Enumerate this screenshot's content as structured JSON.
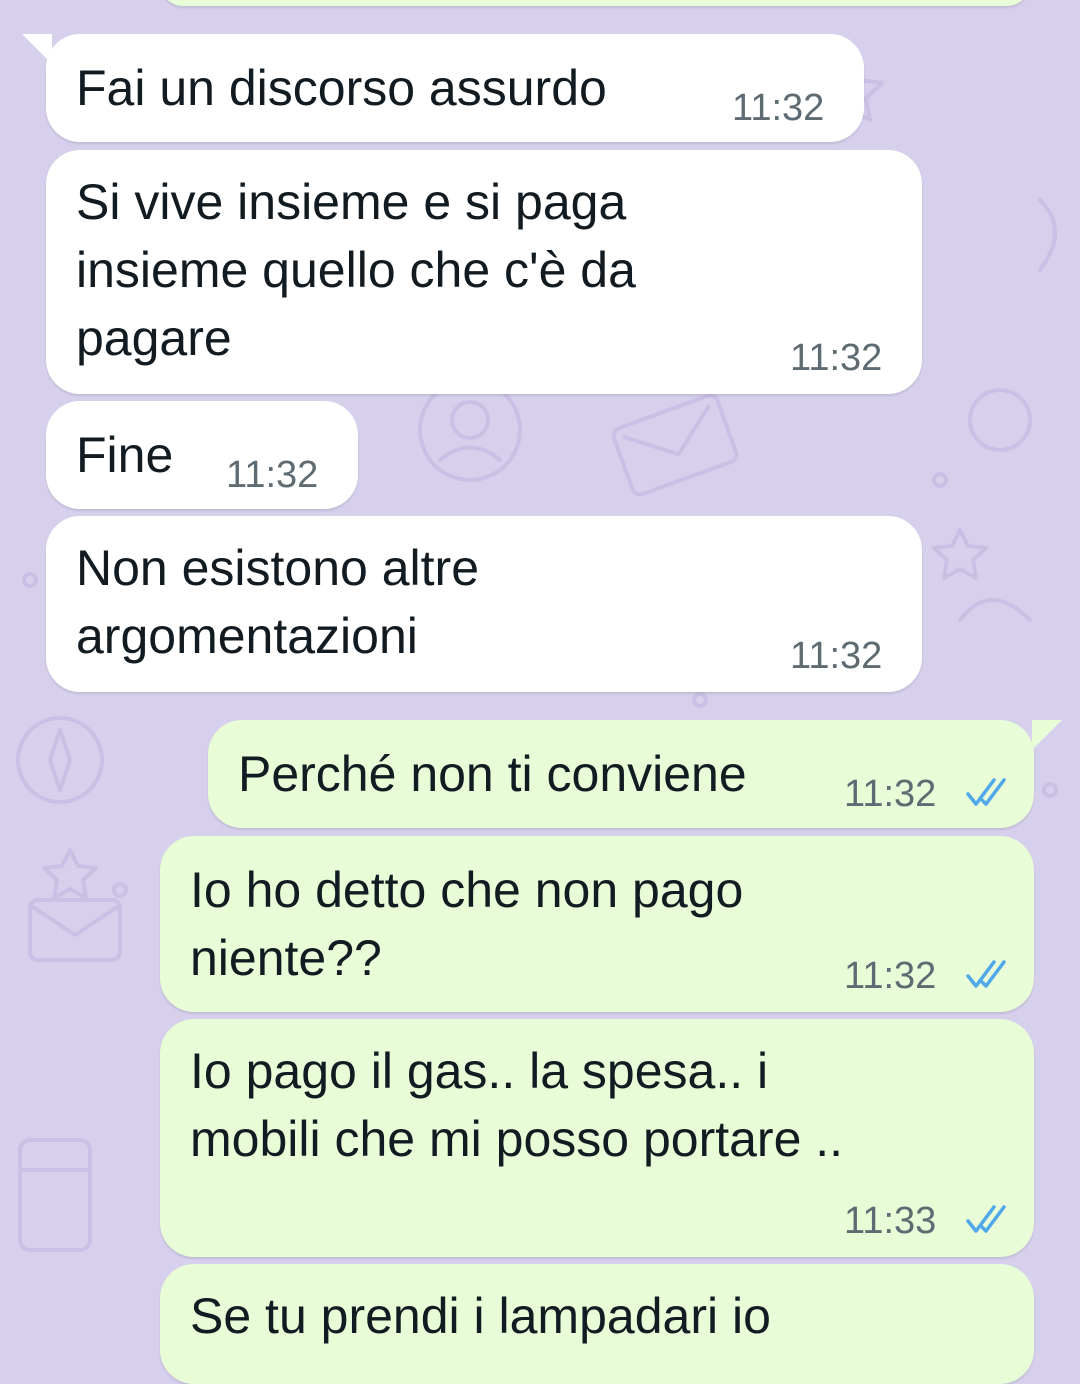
{
  "chat": {
    "messages": [
      {
        "direction": "incoming",
        "text": "Fai un discorso assurdo",
        "time": "11:32"
      },
      {
        "direction": "incoming",
        "text": "Si vive insieme e si paga\ninsieme quello che c'è da\npagare",
        "time": "11:32"
      },
      {
        "direction": "incoming",
        "text": "Fine",
        "time": "11:32"
      },
      {
        "direction": "incoming",
        "text": "Non esistono altre\nargomentazioni",
        "time": "11:32"
      },
      {
        "direction": "outgoing",
        "text": "Perché non ti conviene",
        "time": "11:32",
        "status": "read"
      },
      {
        "direction": "outgoing",
        "text": "Io ho detto che non pago\nniente??",
        "time": "11:32",
        "status": "read"
      },
      {
        "direction": "outgoing",
        "text": "Io pago il gas.. la spesa.. i\nmobili che mi posso portare ..",
        "time": "11:33",
        "status": "read"
      },
      {
        "direction": "outgoing",
        "text": "Se tu prendi i lampadari io"
      }
    ]
  },
  "colors": {
    "background": "#d7d0ed",
    "incoming_bubble": "#ffffff",
    "outgoing_bubble": "#e7fcd7",
    "read_tick": "#4fa8e9",
    "timestamp": "#5f6b73"
  },
  "icons": {
    "read_status": "double-check-icon"
  }
}
